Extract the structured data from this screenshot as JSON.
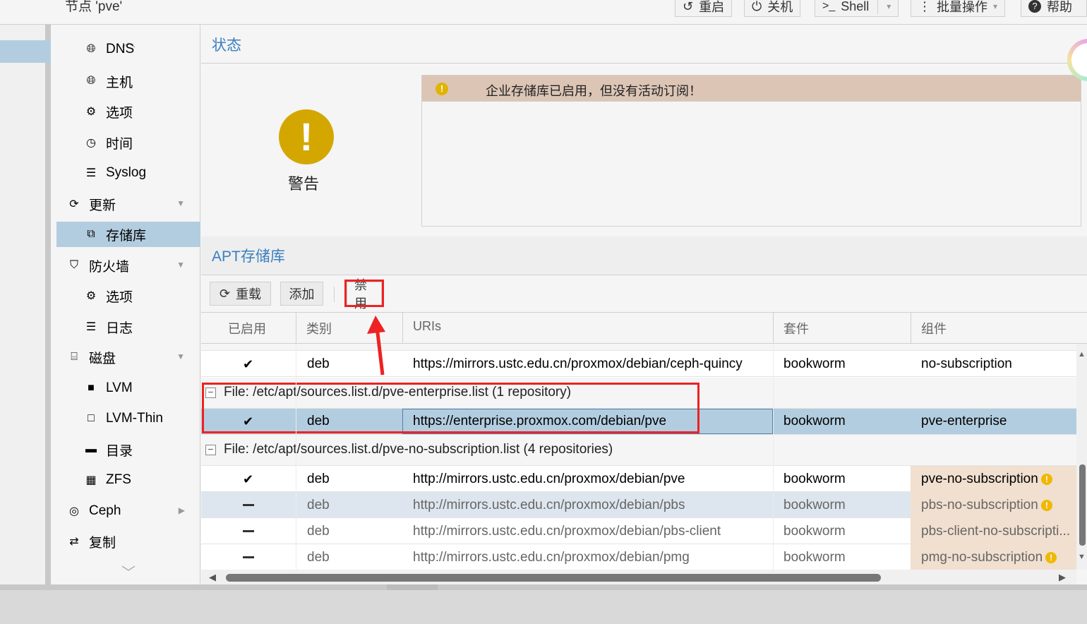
{
  "node_title": "节点 'pve'",
  "toolbar": {
    "reboot": "重启",
    "shutdown": "关机",
    "shell": "Shell",
    "bulk": "批量操作",
    "help": "帮助"
  },
  "nav": {
    "items": [
      {
        "label": "DNS",
        "icon": "globe-icon"
      },
      {
        "label": "主机",
        "icon": "globe-icon"
      },
      {
        "label": "选项",
        "icon": "gear-icon"
      },
      {
        "label": "时间",
        "icon": "clock-icon"
      },
      {
        "label": "Syslog",
        "icon": "list-icon"
      },
      {
        "label": "更新",
        "icon": "refresh-icon"
      },
      {
        "label": "存储库",
        "icon": "copy-icon"
      },
      {
        "label": "防火墙",
        "icon": "shield-icon"
      },
      {
        "label": "选项",
        "icon": "gear-icon"
      },
      {
        "label": "日志",
        "icon": "list-icon"
      },
      {
        "label": "磁盘",
        "icon": "hdd-icon"
      },
      {
        "label": "LVM",
        "icon": "square-icon"
      },
      {
        "label": "LVM-Thin",
        "icon": "square-outline-icon"
      },
      {
        "label": "目录",
        "icon": "folder-icon"
      },
      {
        "label": "ZFS",
        "icon": "grid-icon"
      },
      {
        "label": "Ceph",
        "icon": "ceph-icon"
      },
      {
        "label": "复制",
        "icon": "retweet-icon"
      }
    ]
  },
  "status": {
    "title": "状态",
    "level_label": "警告",
    "message": "企业存储库已启用，但没有活动订阅！"
  },
  "apt": {
    "title": "APT存储库",
    "buttons": {
      "reload": "重载",
      "add": "添加",
      "disable": "禁用"
    },
    "columns": {
      "enabled": "已启用",
      "type": "类别",
      "uris": "URIs",
      "suites": "套件",
      "components": "组件"
    },
    "rows_top": [
      {
        "type": "deb",
        "uri": "https://mirrors.ustc.edu.cn/proxmox/debian/ceph-quincy",
        "suite": "bookworm",
        "component": "no-subscription"
      }
    ],
    "group1": {
      "label": "File: /etc/apt/sources.list.d/pve-enterprise.list (1 repository)",
      "rows": [
        {
          "type": "deb",
          "uri": "https://enterprise.proxmox.com/debian/pve",
          "suite": "bookworm",
          "component": "pve-enterprise"
        }
      ]
    },
    "group2": {
      "label": "File: /etc/apt/sources.list.d/pve-no-subscription.list (4 repositories)",
      "rows": [
        {
          "type": "deb",
          "uri": "http://mirrors.ustc.edu.cn/proxmox/debian/pve",
          "suite": "bookworm",
          "component": "pve-no-subscription"
        },
        {
          "type": "deb",
          "uri": "http://mirrors.ustc.edu.cn/proxmox/debian/pbs",
          "suite": "bookworm",
          "component": "pbs-no-subscription"
        },
        {
          "type": "deb",
          "uri": "http://mirrors.ustc.edu.cn/proxmox/debian/pbs-client",
          "suite": "bookworm",
          "component": "pbs-client-no-subscripti..."
        },
        {
          "type": "deb",
          "uri": "http://mirrors.ustc.edu.cn/proxmox/debian/pmg",
          "suite": "bookworm",
          "component": "pmg-no-subscription"
        }
      ]
    }
  },
  "colors": {
    "accent": "#3a7fc0",
    "selection": "#b3cde0",
    "warning": "#d4a700",
    "annotation_red": "#e22222"
  }
}
